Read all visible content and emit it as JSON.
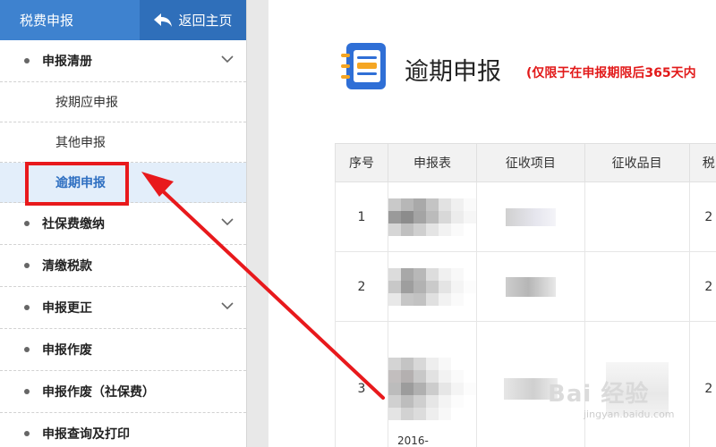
{
  "sidebar": {
    "title": "税费申报",
    "back_label": "返回主页",
    "items": [
      {
        "label": "申报清册",
        "expandable": true
      },
      {
        "label": "按期应申报",
        "sub": true
      },
      {
        "label": "其他申报",
        "sub": true
      },
      {
        "label": "逾期申报",
        "sub": true,
        "active": true
      },
      {
        "label": "社保费缴纳",
        "expandable": true
      },
      {
        "label": "清缴税款"
      },
      {
        "label": "申报更正",
        "expandable": true
      },
      {
        "label": "申报作废"
      },
      {
        "label": "申报作废（社保费）"
      },
      {
        "label": "申报查询及打印"
      }
    ]
  },
  "main": {
    "title": "逾期申报",
    "note": "(仅限于在申报期限后365天内",
    "table": {
      "headers": [
        "序号",
        "申报表",
        "征收项目",
        "征收品目",
        "税"
      ],
      "rows": [
        {
          "index": "1",
          "last": "2"
        },
        {
          "index": "2",
          "last": "2"
        },
        {
          "index": "3",
          "last": "2"
        }
      ],
      "partial_row_text": "2016-"
    }
  },
  "watermark": {
    "brand": "Bai 经验",
    "url": "jingyan.baidu.com"
  },
  "colors": {
    "header_blue": "#3e82cf",
    "active_blue": "#2e6fc1",
    "annotation_red": "#e8191c",
    "note_red": "#e21a1a"
  }
}
